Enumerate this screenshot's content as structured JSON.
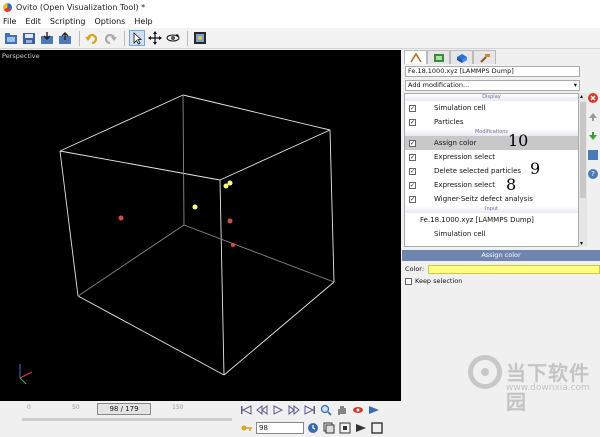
{
  "window": {
    "title": "Ovito (Open Visualization Tool) *"
  },
  "menu": [
    "File",
    "Edit",
    "Scripting",
    "Options",
    "Help"
  ],
  "toolbar": {
    "icons": [
      "open-file-icon",
      "save-icon",
      "import-icon",
      "export-icon",
      "undo-icon",
      "redo-icon",
      "select-mode-icon",
      "move-icon",
      "orbit-icon",
      "render-icon"
    ]
  },
  "viewport": {
    "label": "Perspective"
  },
  "panel": {
    "tabs": [
      "pipeline-tab-icon",
      "render-tab-icon",
      "overlays-tab-icon",
      "utilities-tab-icon"
    ],
    "pipeline_name": "Fe.18.1000.xyz [LAMMPS Dump]",
    "add_modification": "Add modification...",
    "sections": {
      "display": "Display",
      "modifications": "Modifications",
      "input": "Input"
    },
    "display_items": [
      {
        "label": "Simulation cell",
        "checked": true
      },
      {
        "label": "Particles",
        "checked": true
      }
    ],
    "modification_items": [
      {
        "label": "Assign color",
        "checked": true,
        "selected": true,
        "annotation": "10"
      },
      {
        "label": "Expression select",
        "checked": true,
        "selected": false,
        "annotation": ""
      },
      {
        "label": "Delete selected particles",
        "checked": true,
        "selected": false,
        "annotation": "9"
      },
      {
        "label": "Expression select",
        "checked": true,
        "selected": false,
        "annotation": "8"
      },
      {
        "label": "Wigner-Seitz defect analysis",
        "checked": true,
        "selected": false,
        "annotation": ""
      }
    ],
    "input_items": [
      {
        "label": "Fe.18.1000.xyz [LAMMPS Dump]"
      },
      {
        "label": "Simulation cell"
      }
    ],
    "editor": {
      "header": "Assign color",
      "color_label": "Color:",
      "color_value": "#ffff80",
      "keep_selection_label": "Keep selection",
      "keep_selection_checked": false
    }
  },
  "animation": {
    "tick_labels": [
      "0",
      "50",
      "100",
      "150"
    ],
    "frame_display": "98 / 179",
    "current_frame": "98",
    "current": 98,
    "total": 179
  },
  "watermark": {
    "name": "当下软件园",
    "url": "www.downxia.com"
  }
}
